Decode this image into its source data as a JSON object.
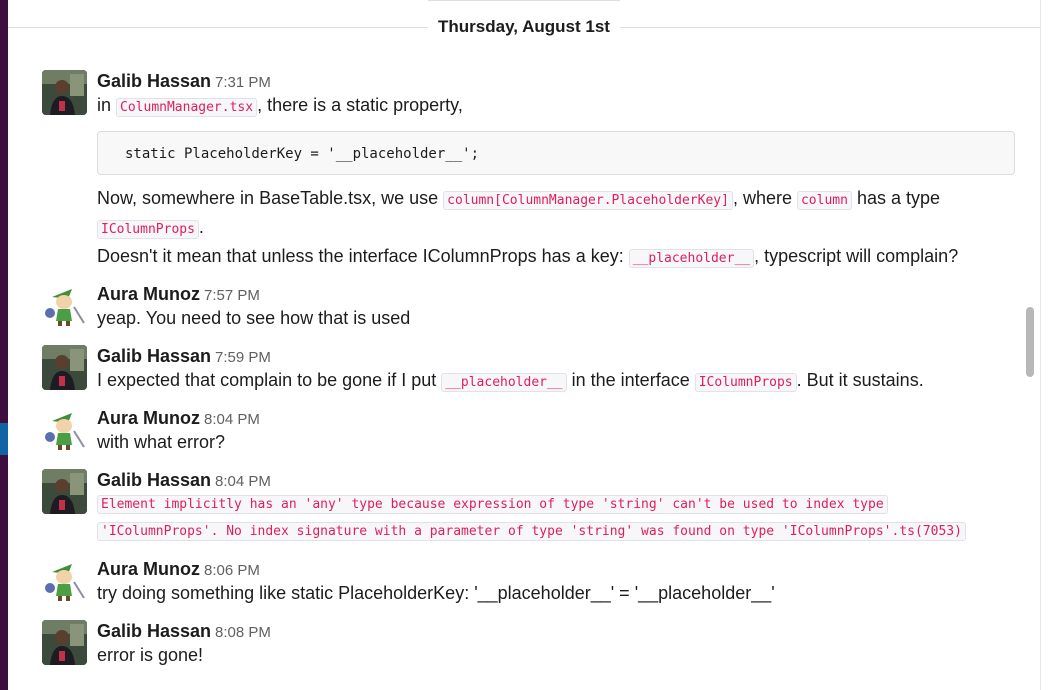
{
  "day_divider": "Thursday, August 1st",
  "messages": [
    {
      "author": "Galib Hassan",
      "time": "7:31 PM",
      "line1": {
        "pre": "in ",
        "code": "ColumnManager.tsx",
        "post": ", there is a static property,"
      },
      "code_block": "static PlaceholderKey = '__placeholder__';",
      "line2": {
        "pre": "Now, somewhere in BaseTable.tsx, we use ",
        "code1": "column[ColumnManager.PlaceholderKey]",
        "mid": ", where ",
        "code2": "column",
        "post": " has a type"
      },
      "line3": {
        "code": "IColumnProps",
        "post": "."
      },
      "line4": {
        "pre": "Doesn't it mean that unless the interface IColumnProps has a key: ",
        "code": "__placeholder__",
        "post": ",  typescript will complain?"
      }
    },
    {
      "author": "Aura Munoz",
      "time": "7:57 PM",
      "text": "yeap. You need to see how that is used"
    },
    {
      "author": "Galib Hassan",
      "time": "7:59 PM",
      "pre": "I expected that complain to be gone if I put ",
      "code1": "__placeholder__",
      "mid": " in the interface ",
      "code2": "IColumnProps",
      "post": ". But it sustains."
    },
    {
      "author": "Aura Munoz",
      "time": "8:04 PM",
      "text": "with what error?"
    },
    {
      "author": "Galib Hassan",
      "time": "8:04 PM",
      "error_line1": "Element implicitly has an 'any' type because expression of type 'string' can't be used to index type",
      "error_line2": "'IColumnProps'. No index signature with a parameter of type 'string' was found on type 'IColumnProps'.ts(7053)"
    },
    {
      "author": "Aura Munoz",
      "time": "8:06 PM",
      "text": "try doing something like static PlaceholderKey: '__placeholder__' = '__placeholder__'"
    },
    {
      "author": "Galib Hassan",
      "time": "8:08 PM",
      "text": "error is gone!"
    }
  ]
}
